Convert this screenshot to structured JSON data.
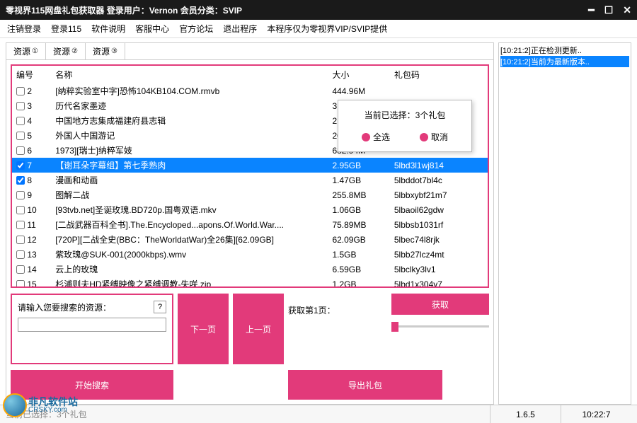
{
  "titlebar": "零视界115网盘礼包获取器   登录用户：Vernon   会员分类：SVIP",
  "menu": [
    "注销登录",
    "登录115",
    "软件说明",
    "客服中心",
    "官方论坛",
    "退出程序",
    "本程序仅为零视界VIP/SVIP提供"
  ],
  "tabs": [
    {
      "label": "资源",
      "icon": "①"
    },
    {
      "label": "资源",
      "icon": "②"
    },
    {
      "label": "资源",
      "icon": "③"
    }
  ],
  "columns": {
    "num": "编号",
    "name": "名称",
    "size": "大小",
    "code": "礼包码"
  },
  "rows": [
    {
      "n": "2",
      "chk": false,
      "name": "[纳粹实验室中字]恐怖104KB104.COM.rmvb",
      "size": "444.96M",
      "code": ""
    },
    {
      "n": "3",
      "chk": false,
      "name": "历代名家墨迹",
      "size": "3.57GB",
      "code": ""
    },
    {
      "n": "4",
      "chk": false,
      "name": "中国地方志集成福建府县志辑",
      "size": "2.87GB",
      "code": ""
    },
    {
      "n": "5",
      "chk": false,
      "name": "外国人中国游记",
      "size": "207.76M",
      "code": ""
    },
    {
      "n": "6",
      "chk": false,
      "name": "1973][瑞士]纳粹军妓",
      "size": "682.94M",
      "code": ""
    },
    {
      "n": "7",
      "chk": true,
      "sel": true,
      "name": "【谢耳朵字幕组】第七季熟肉",
      "size": "2.95GB",
      "code": "5lbd3l1wj814"
    },
    {
      "n": "8",
      "chk": true,
      "name": "漫画和动画",
      "size": "1.47GB",
      "code": "5lbddot7bl4c"
    },
    {
      "n": "9",
      "chk": false,
      "name": "图解二战",
      "size": "255.8MB",
      "code": "5lbbxybf21m7"
    },
    {
      "n": "10",
      "chk": false,
      "name": "[93tvb.net]圣诞玫瑰.BD720p.国粤双语.mkv",
      "size": "1.06GB",
      "code": "5lbaoil62gdw"
    },
    {
      "n": "11",
      "chk": false,
      "name": "[二战武器百科全书].The.Encycloped...apons.Of.World.War....",
      "size": "75.89MB",
      "code": "5lbbsb1031rf"
    },
    {
      "n": "12",
      "chk": false,
      "name": "[720P][二战全史(BBC：TheWorldatWar)全26集][62.09GB]",
      "size": "62.09GB",
      "code": "5lbec74l8rjk"
    },
    {
      "n": "13",
      "chk": false,
      "name": "紫玫瑰@SUK-001(2000kbps).wmv",
      "size": "1.5GB",
      "code": "5lbb27lcz4mt"
    },
    {
      "n": "14",
      "chk": false,
      "name": "云上的玫瑰",
      "size": "6.59GB",
      "code": "5lbclky3lv1"
    },
    {
      "n": "15",
      "chk": false,
      "name": "杉浦则夫HD紧缚映像之紧缚调教-失咲.zip",
      "size": "1.2GB",
      "code": "5lbd1x304y7"
    }
  ],
  "popup": {
    "title": "当前已选择：3个礼包",
    "opt1": "全选",
    "opt2": "取消"
  },
  "search": {
    "label": "请输入您要搜索的资源：",
    "help": "?",
    "value": "",
    "btn": "开始搜索"
  },
  "nav": {
    "prev": "下一页",
    "next": "上一页"
  },
  "export": {
    "label": "获取第1页：",
    "btn": "导出礼包"
  },
  "fetch": {
    "btn": "获取"
  },
  "log": [
    {
      "t": "[10:21:2]正在检测更新..",
      "sel": false
    },
    {
      "t": "[10:21:2]当前为最新版本..",
      "sel": true
    }
  ],
  "status": {
    "left": "当前已选择：3个礼包",
    "version": "1.6.5",
    "time": "10:22:7"
  },
  "watermark": {
    "cn": "非凡软件站",
    "en": "CRSKY.com"
  }
}
